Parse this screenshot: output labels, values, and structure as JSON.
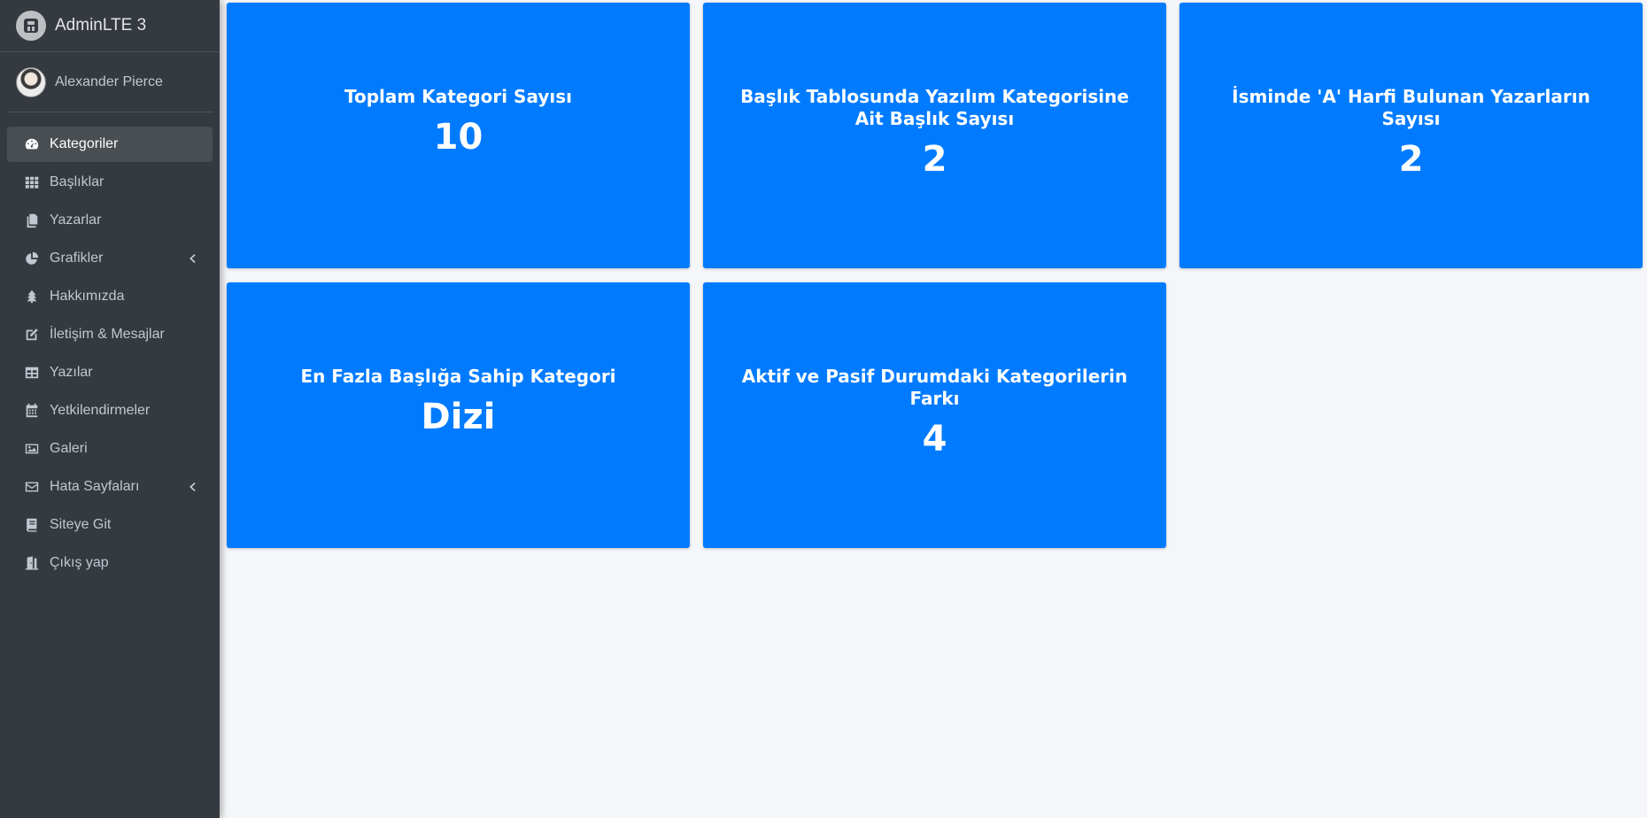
{
  "brand": {
    "title": "AdminLTE 3",
    "logo_icon": "adminlte-logo-icon"
  },
  "user": {
    "name": "Alexander Pierce"
  },
  "colors": {
    "sidebar": "#343a40",
    "card": "#007bff",
    "background": "#f4f6f9",
    "active_item": "#494e53"
  },
  "sidebar": {
    "items": [
      {
        "label": "Kategoriler",
        "icon": "tachometer-icon",
        "active": true,
        "has_submenu": false
      },
      {
        "label": "Başlıklar",
        "icon": "th-grid-icon",
        "active": false,
        "has_submenu": false
      },
      {
        "label": "Yazarlar",
        "icon": "copy-icon",
        "active": false,
        "has_submenu": false
      },
      {
        "label": "Grafikler",
        "icon": "pie-chart-icon",
        "active": false,
        "has_submenu": true
      },
      {
        "label": "Hakkımızda",
        "icon": "tree-icon",
        "active": false,
        "has_submenu": false
      },
      {
        "label": "İletişim & Mesajlar",
        "icon": "edit-icon",
        "active": false,
        "has_submenu": false
      },
      {
        "label": "Yazılar",
        "icon": "table-icon",
        "active": false,
        "has_submenu": false
      },
      {
        "label": "Yetkilendirmeler",
        "icon": "calendar-icon",
        "active": false,
        "has_submenu": false
      },
      {
        "label": "Galeri",
        "icon": "image-icon",
        "active": false,
        "has_submenu": false
      },
      {
        "label": "Hata Sayfaları",
        "icon": "envelope-icon",
        "active": false,
        "has_submenu": true
      },
      {
        "label": "Siteye Git",
        "icon": "book-icon",
        "active": false,
        "has_submenu": false
      },
      {
        "label": "Çıkış yap",
        "icon": "door-exit-icon",
        "active": false,
        "has_submenu": false
      }
    ]
  },
  "cards": [
    {
      "title": "Toplam Kategori Sayısı",
      "value": "10"
    },
    {
      "title": "Başlık Tablosunda Yazılım Kategorisine Ait Başlık Sayısı",
      "value": "2"
    },
    {
      "title": "İsminde 'A' Harfi Bulunan Yazarların Sayısı",
      "value": "2"
    },
    {
      "title": "En Fazla Başlığa Sahip Kategori",
      "value": "Dizi"
    },
    {
      "title": "Aktif ve Pasif Durumdaki Kategorilerin Farkı",
      "value": "4"
    }
  ]
}
